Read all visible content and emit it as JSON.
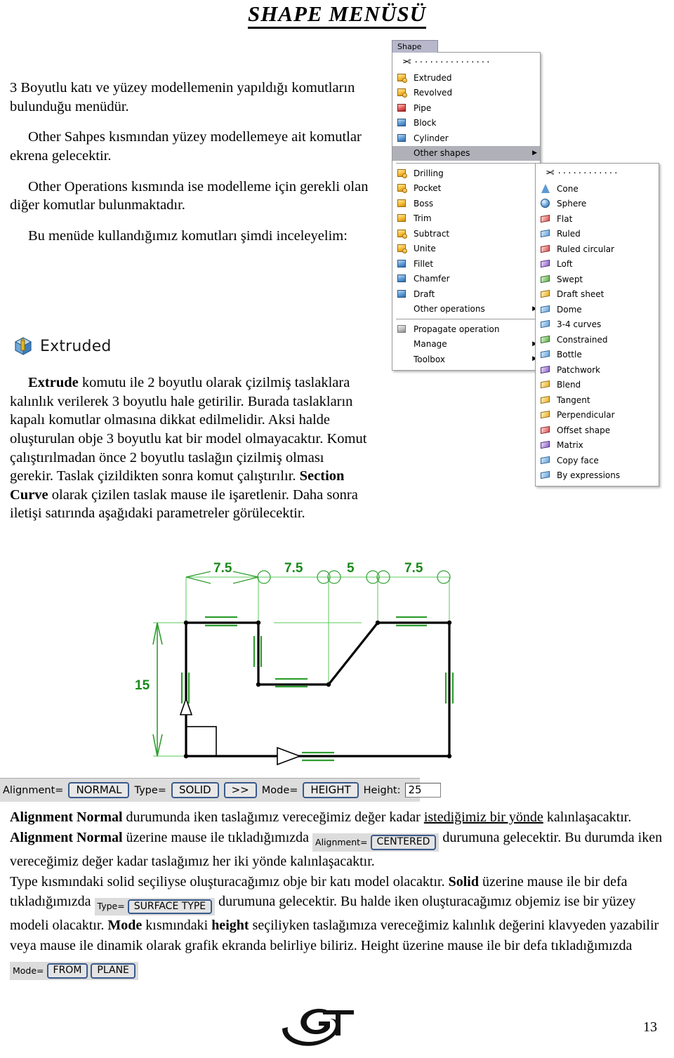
{
  "document": {
    "title": "SHAPE MENÜSÜ",
    "page_number": "13",
    "logo_text": "GT"
  },
  "intro": {
    "p1": "3 Boyutlu katı ve yüzey modellemenin yapıldığı komutların bulunduğu menüdür.",
    "p2": "Other Sahpes kısmından yüzey modellemeye ait komutlar ekrena gelecektir.",
    "p3": "Other Operations kısmında ise modelleme için gerekli olan diğer komutlar bulunmaktadır.",
    "p4": "Bu menüde kullandığımız komutları şimdi inceleyelim:"
  },
  "extruded_section": {
    "heading": "Extruded",
    "heading_icon": "extruded-icon",
    "body_lead": "Extrude",
    "body_rest_1": " komutu ile 2 boyutlu olarak çizilmiş taslaklara kalınlık verilerek 3 boyutlu hale getirilir. Burada taslakların kapalı komutlar olmasına dikkat edilmelidir. Aksi halde oluşturulan obje 3 boyutlu kat bir model olmayacaktır. Komut çalıştırılmadan önce 2 boyutlu taslağın çizilmiş olması gerekir. Taslak çizildikten sonra komut çalıştırılır. ",
    "body_bold_2": "Section Curve",
    "body_rest_2": " olarak çizilen taslak mause ile işaretlenir. Daha sonra iletişi satırında aşağıdaki parametreler görülecektir."
  },
  "menu": {
    "tab_label": "Shape",
    "tearoff_icon": "scissors-icon",
    "items": [
      {
        "label": "Extruded",
        "icon": "extruded-icon",
        "icon_style": "cube blue pip yellow",
        "submenu": false,
        "selected": false
      },
      {
        "label": "Revolved",
        "icon": "revolved-icon",
        "icon_style": "cube blue pip yellow",
        "submenu": false,
        "selected": false
      },
      {
        "label": "Pipe",
        "icon": "pipe-icon",
        "icon_style": "cube red",
        "submenu": false,
        "selected": false
      },
      {
        "label": "Block",
        "icon": "block-icon",
        "icon_style": "cube blue",
        "submenu": false,
        "selected": false
      },
      {
        "label": "Cylinder",
        "icon": "cylinder-icon",
        "icon_style": "cube blue",
        "submenu": false,
        "selected": false
      },
      {
        "label": "Other shapes",
        "icon": "",
        "icon_style": "",
        "submenu": true,
        "selected": true
      },
      {
        "label": "Drilling",
        "icon": "drilling-icon",
        "icon_style": "cube blue pip yellow",
        "submenu": false,
        "selected": false
      },
      {
        "label": "Pocket",
        "icon": "pocket-icon",
        "icon_style": "cube blue pip yellow",
        "submenu": false,
        "selected": false
      },
      {
        "label": "Boss",
        "icon": "boss-icon",
        "icon_style": "cube yellow",
        "submenu": false,
        "selected": false
      },
      {
        "label": "Trim",
        "icon": "trim-icon",
        "icon_style": "cube yellow",
        "submenu": false,
        "selected": false
      },
      {
        "label": "Subtract",
        "icon": "subtract-icon",
        "icon_style": "cube blue pip yellow",
        "submenu": false,
        "selected": false
      },
      {
        "label": "Unite",
        "icon": "unite-icon",
        "icon_style": "cube blue pip yellow",
        "submenu": false,
        "selected": false
      },
      {
        "label": "Fillet",
        "icon": "fillet-icon",
        "icon_style": "cube blue",
        "submenu": false,
        "selected": false
      },
      {
        "label": "Chamfer",
        "icon": "chamfer-icon",
        "icon_style": "cube blue",
        "submenu": false,
        "selected": false
      },
      {
        "label": "Draft",
        "icon": "draft-icon",
        "icon_style": "cube blue",
        "submenu": false,
        "selected": false
      },
      {
        "label": "Other operations",
        "icon": "",
        "icon_style": "",
        "submenu": true,
        "selected": false
      },
      {
        "label": "Propagate operation",
        "icon": "propagate-icon",
        "icon_style": "cube gray",
        "submenu": false,
        "selected": false
      },
      {
        "label": "Manage",
        "icon": "",
        "icon_style": "",
        "submenu": true,
        "selected": false
      },
      {
        "label": "Toolbox",
        "icon": "",
        "icon_style": "",
        "submenu": true,
        "selected": false
      }
    ],
    "separators_after": [
      5,
      15
    ],
    "submenu": {
      "tearoff_icon": "scissors-icon",
      "items": [
        {
          "label": "Cone",
          "icon": "cone-icon"
        },
        {
          "label": "Sphere",
          "icon": "sphere-icon"
        },
        {
          "label": "Flat",
          "icon": "flat-icon"
        },
        {
          "label": "Ruled",
          "icon": "ruled-icon"
        },
        {
          "label": "Ruled circular",
          "icon": "ruled-circular-icon"
        },
        {
          "label": "Loft",
          "icon": "loft-icon"
        },
        {
          "label": "Swept",
          "icon": "swept-icon"
        },
        {
          "label": "Draft sheet",
          "icon": "draft-sheet-icon"
        },
        {
          "label": "Dome",
          "icon": "dome-icon"
        },
        {
          "label": "3-4 curves",
          "icon": "three-four-curves-icon"
        },
        {
          "label": "Constrained",
          "icon": "constrained-icon"
        },
        {
          "label": "Bottle",
          "icon": "bottle-icon"
        },
        {
          "label": "Patchwork",
          "icon": "patchwork-icon"
        },
        {
          "label": "Blend",
          "icon": "blend-icon"
        },
        {
          "label": "Tangent",
          "icon": "tangent-icon"
        },
        {
          "label": "Perpendicular",
          "icon": "perpendicular-icon"
        },
        {
          "label": "Offset shape",
          "icon": "offset-shape-icon"
        },
        {
          "label": "Matrix",
          "icon": "matrix-icon"
        },
        {
          "label": "Copy face",
          "icon": "copy-face-icon"
        },
        {
          "label": "By expressions",
          "icon": "by-expressions-icon"
        }
      ]
    }
  },
  "drawing": {
    "color": "#00a000",
    "dim_top": [
      "7.5",
      "7.5",
      "5",
      "7.5"
    ],
    "dim_left": "15"
  },
  "statusbar": {
    "alignment_label": "Alignment=",
    "alignment_value": "NORMAL",
    "type_label": "Type=",
    "type_value": "SOLID",
    "more_button": ">>",
    "mode_label": "Mode=",
    "mode_value": "HEIGHT",
    "height_label": "Height:",
    "height_value": "25"
  },
  "bottom": {
    "b1": "Alignment Normal",
    "t1": " durumunda iken taslağımız vereceğimiz değer kadar ",
    "u1": "istediğimiz bir yönde",
    "t2": " kalınlaşacaktır. ",
    "b2": "Alignment Normal",
    "t3": " üzerine mause ile tıkladığımızda ",
    "w1_label": "Alignment=",
    "w1_value": "CENTERED",
    "t4": " durumuna gelecektir. Bu durumda iken vereceğimiz değer kadar taslağımız her iki yönde kalınlaşacaktır.",
    "t5": "Type kısmındaki solid seçiliyse oluşturacağımız obje bir katı model olacaktır. ",
    "b3": "Solid",
    "t6": " üzerine mause ile bir defa tıkladığımızda ",
    "w2_label": "Type=",
    "w2_value": "SURFACE TYPE",
    "t7": " durumuna gelecektir. Bu halde iken oluşturacağımız objemiz ise bir yüzey modeli olacaktır. ",
    "b4": "Mode",
    "t8": " kısmındaki ",
    "b5": "height",
    "t9": " seçiliyken taslağımıza vereceğimiz kalınlık değerini klavyeden yazabilir veya mause ile dinamik olarak grafik ekranda belirliye biliriz. Height üzerine mause ile bir defa tıkladığımızda ",
    "w3_label": "Mode=",
    "w3_value1": "FROM",
    "w3_value2": "PLANE"
  }
}
